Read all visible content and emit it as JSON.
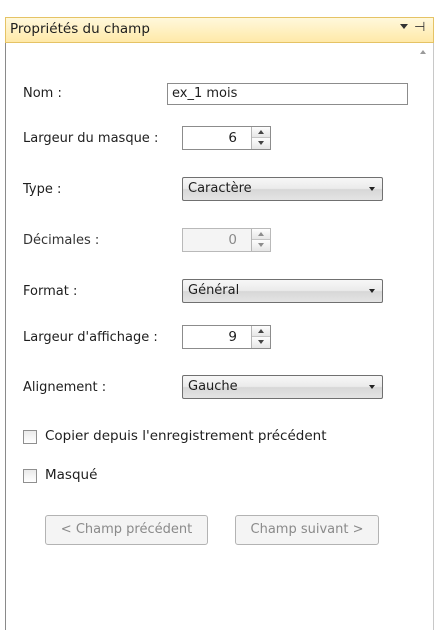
{
  "panel": {
    "title": "Propriétés du champ",
    "pin_glyph": "⊣"
  },
  "fields": {
    "nom": {
      "label": "Nom :",
      "value": "ex_1 mois"
    },
    "largeur_masque": {
      "label": "Largeur du masque :",
      "value": "6"
    },
    "type": {
      "label": "Type :",
      "value": "Caractère"
    },
    "decimales": {
      "label": "Décimales :",
      "value": "0",
      "disabled": true
    },
    "format": {
      "label": "Format :",
      "value": "Général"
    },
    "largeur_affichage": {
      "label": "Largeur d'affichage :",
      "value": "9"
    },
    "alignement": {
      "label": "Alignement :",
      "value": "Gauche"
    }
  },
  "checkboxes": {
    "copier": {
      "label": "Copier depuis l'enregistrement précédent",
      "checked": false
    },
    "masque": {
      "label": "Masqué",
      "checked": false
    }
  },
  "buttons": {
    "prev": "< Champ précédent",
    "next": "Champ suivant >"
  },
  "colors": {
    "title_bar_gradient": [
      "#fff8dc",
      "#ffe9a8"
    ],
    "disabled_text": "#8a8a8a"
  }
}
